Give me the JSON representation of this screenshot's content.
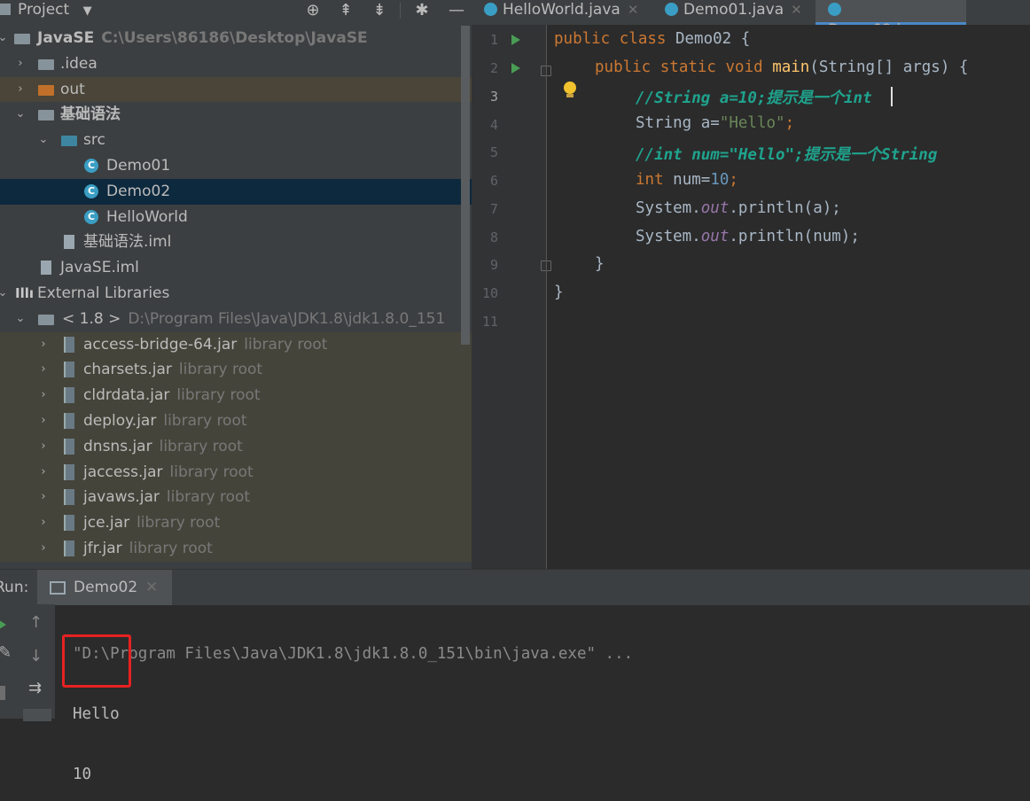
{
  "project_panel": {
    "title": "Project",
    "header_icons": [
      "crosshair-icon",
      "expand-all-icon",
      "collapse-all-icon",
      "gear-icon",
      "minimize-icon"
    ]
  },
  "tree": [
    {
      "label": "JavaSE",
      "hint": "C:\\Users\\86186\\Desktop\\JavaSE",
      "kind": "module-folder"
    },
    {
      "label": ".idea",
      "kind": "folder"
    },
    {
      "label": "out",
      "kind": "excluded-folder"
    },
    {
      "label": "基础语法",
      "kind": "module-folder"
    },
    {
      "label": "src",
      "kind": "source-folder"
    },
    {
      "label": "Demo01",
      "kind": "class"
    },
    {
      "label": "Demo02",
      "kind": "class"
    },
    {
      "label": "HelloWorld",
      "kind": "class"
    },
    {
      "label": "基础语法.iml",
      "kind": "iml-file"
    },
    {
      "label": "JavaSE.iml",
      "kind": "iml-file"
    },
    {
      "label": "External Libraries",
      "kind": "libraries"
    },
    {
      "label": "< 1.8 >",
      "hint": "D:\\Program Files\\Java\\JDK1.8\\jdk1.8.0_151",
      "kind": "sdk"
    },
    {
      "label": "access-bridge-64.jar",
      "hint": "library root",
      "kind": "jar"
    },
    {
      "label": "charsets.jar",
      "hint": "library root",
      "kind": "jar"
    },
    {
      "label": "cldrdata.jar",
      "hint": "library root",
      "kind": "jar"
    },
    {
      "label": "deploy.jar",
      "hint": "library root",
      "kind": "jar"
    },
    {
      "label": "dnsns.jar",
      "hint": "library root",
      "kind": "jar"
    },
    {
      "label": "jaccess.jar",
      "hint": "library root",
      "kind": "jar"
    },
    {
      "label": "javaws.jar",
      "hint": "library root",
      "kind": "jar"
    },
    {
      "label": "jce.jar",
      "hint": "library root",
      "kind": "jar"
    },
    {
      "label": "jfr.jar",
      "hint": "library root",
      "kind": "jar"
    }
  ],
  "tabs": [
    {
      "label": "HelloWorld.java",
      "active": false
    },
    {
      "label": "Demo01.java",
      "active": false
    },
    {
      "label": "Demo02.java",
      "active": true
    }
  ],
  "editor": {
    "line_numbers": [
      "1",
      "2",
      "3",
      "4",
      "5",
      "6",
      "7",
      "8",
      "9",
      "10",
      "11"
    ],
    "current_line": "3",
    "code": {
      "l1_kw": "public class ",
      "l1_name": "Demo02 {",
      "l2_kw": "public static void ",
      "l2_fn": "main",
      "l2_rest": "(String[] args) {",
      "l3_cmt": "//String a=10;提示是一个int",
      "l4_a": "String a=",
      "l4_str": "\"Hello\"",
      "l4_b": ";",
      "l5_cmt": "//int num=\"Hello\";提示是一个String",
      "l6_kw": "int ",
      "l6_a": "num=",
      "l6_num": "10",
      "l6_b": ";",
      "l7_a": "System.",
      "l7_fld": "out",
      "l7_b": ".println(a);",
      "l8_a": "System.",
      "l8_fld": "out",
      "l8_b": ".println(num);",
      "l9": "}",
      "l10": "}"
    }
  },
  "run_panel": {
    "label": "Run:",
    "tab_label": "Demo02",
    "command": "\"D:\\Program Files\\Java\\JDK1.8\\jdk1.8.0_151\\bin\\java.exe\" ...",
    "output": [
      "Hello",
      "10"
    ]
  },
  "colors": {
    "keyword": "#cc7832",
    "string": "#6a8759",
    "number": "#6897bb",
    "comment": "#1fa38e",
    "selection": "#0d293e",
    "highlight_box": "#e82121"
  }
}
